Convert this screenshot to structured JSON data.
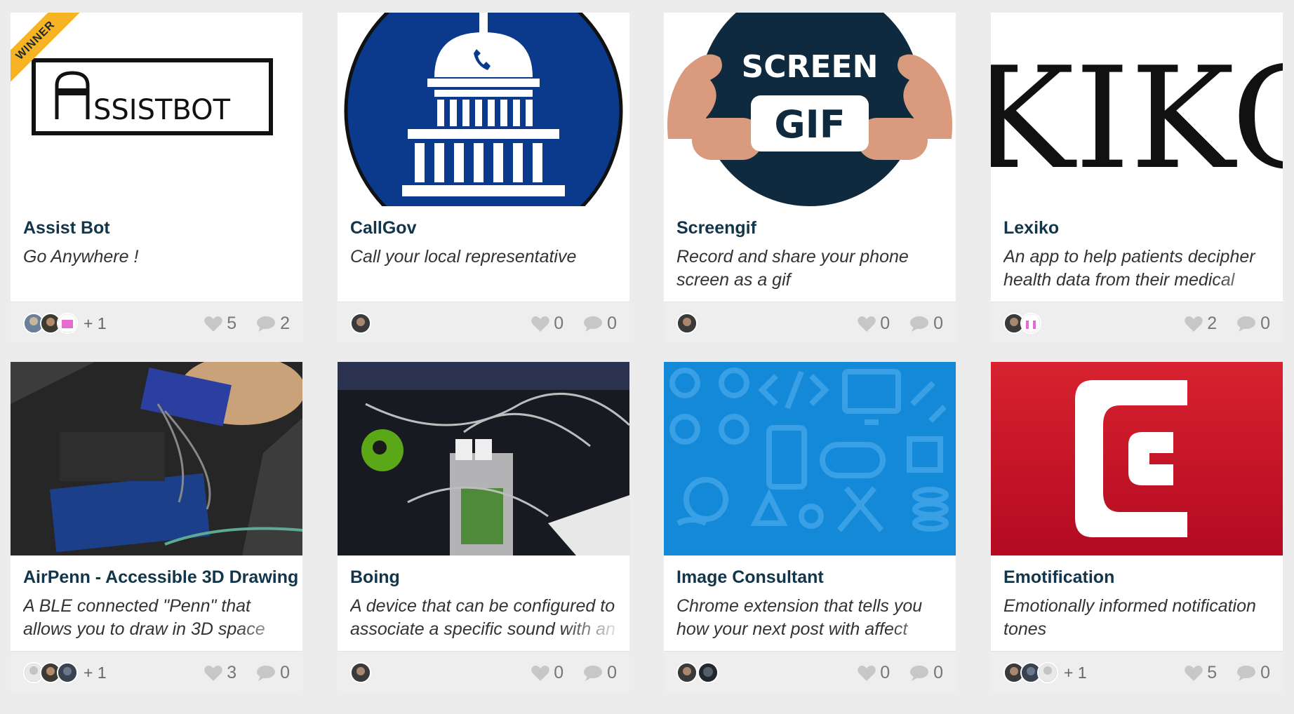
{
  "cards": [
    {
      "title": "Assist Bot",
      "desc": "Go Anywhere !",
      "likes": "5",
      "comments": "2",
      "plus": "+ 1",
      "ribbon": "WINNER",
      "logo_text": "SSISTBOT"
    },
    {
      "title": "CallGov",
      "desc": "Call your local representative",
      "likes": "0",
      "comments": "0",
      "plus": ""
    },
    {
      "title": "Screengif",
      "desc": "Record and share your phone screen as a gif",
      "likes": "0",
      "comments": "0",
      "plus": "",
      "logo_top": "SCREEN",
      "logo_mid": "GIF"
    },
    {
      "title": "Lexiko",
      "desc": "An app to help patients decipher health data from their medical",
      "likes": "2",
      "comments": "0",
      "plus": "",
      "logo_text": "KIKO"
    },
    {
      "title": "AirPenn - Accessible 3D Drawing",
      "desc": "A BLE connected \"Penn\" that allows you to draw in 3D space",
      "likes": "3",
      "comments": "0",
      "plus": "+ 1"
    },
    {
      "title": "Boing",
      "desc": "A device that can be configured to associate a specific sound with an",
      "likes": "0",
      "comments": "0",
      "plus": ""
    },
    {
      "title": "Image Consultant",
      "desc": "Chrome extension that tells you how your next post with affect",
      "likes": "0",
      "comments": "0",
      "plus": ""
    },
    {
      "title": "Emotification",
      "desc": "Emotionally informed notification tones",
      "likes": "5",
      "comments": "0",
      "plus": "+ 1"
    }
  ],
  "colors": {
    "title": "#13354a",
    "ribbon": "#f6b425",
    "callgov_blue": "#0b3a8c",
    "screengif_navy": "#0f2a3f",
    "consultant_blue": "#1489d8",
    "emotification_red": "#c8102e"
  }
}
